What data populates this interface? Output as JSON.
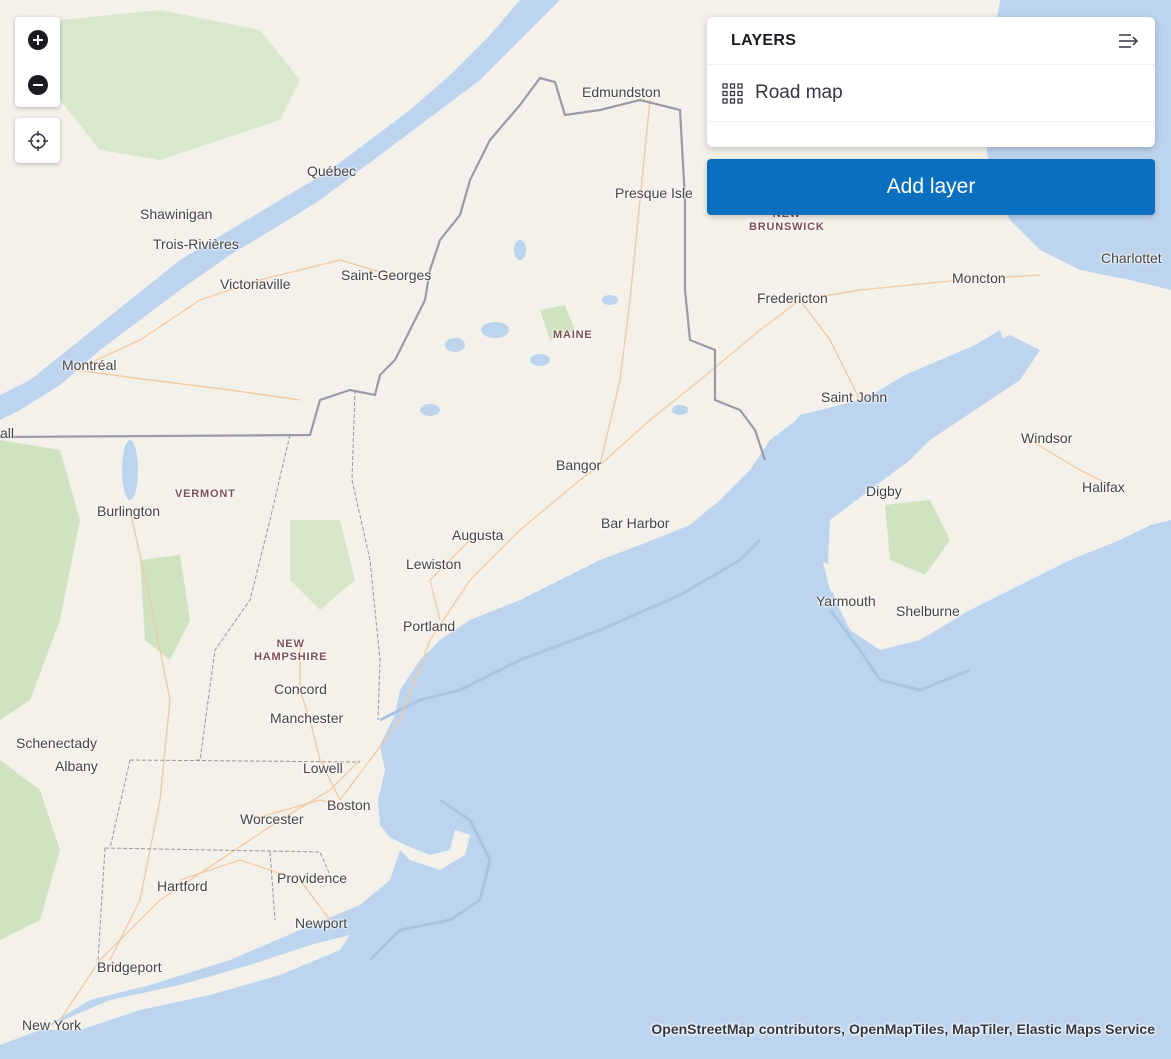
{
  "zoom_controls": {
    "zoom_in_icon": "plus-icon",
    "zoom_out_icon": "minus-icon",
    "locate_icon": "crosshair-icon"
  },
  "layers_panel": {
    "title": "LAYERS",
    "collapse_icon": "collapse-panel-icon",
    "layers": [
      {
        "name": "Road map",
        "icon": "grid-icon"
      }
    ],
    "add_layer_label": "Add layer"
  },
  "attribution": "OpenStreetMap contributors, OpenMapTiles, MapTiler, Elastic Maps Service",
  "colors": {
    "water": "#bcd4ee",
    "land": "#f4f0ea",
    "forest": "#cfe3c0",
    "accent": "#0a6fbf"
  },
  "map_labels": {
    "edmundston": "Edmundston",
    "quebec": "Québec",
    "presque_isle": "Presque Isle",
    "new_brunswick_1": "NEW",
    "new_brunswick_2": "BRUNSWICK",
    "shawinigan": "Shawinigan",
    "trois_rivieres": "Trois-Rivières",
    "victoriaville": "Victoriaville",
    "saint_georges": "Saint-Georges",
    "charlottetown": "Charlottet",
    "moncton": "Moncton",
    "fredericton": "Fredericton",
    "maine": "MAINE",
    "montreal": "Montréal",
    "saint_john": "Saint John",
    "edge_all": "all",
    "windsor": "Windsor",
    "bangor": "Bangor",
    "vermont": "VERMONT",
    "digby": "Digby",
    "halifax": "Halifax",
    "burlington": "Burlington",
    "bar_harbor": "Bar Harbor",
    "augusta": "Augusta",
    "lewiston": "Lewiston",
    "yarmouth": "Yarmouth",
    "shelburne": "Shelburne",
    "portland": "Portland",
    "new_hampshire_1": "NEW",
    "new_hampshire_2": "HAMPSHIRE",
    "concord": "Concord",
    "manchester": "Manchester",
    "schenectady": "Schenectady",
    "albany": "Albany",
    "lowell": "Lowell",
    "boston": "Boston",
    "worcester": "Worcester",
    "hartford": "Hartford",
    "providence": "Providence",
    "newport": "Newport",
    "bridgeport": "Bridgeport",
    "new_york": "New York"
  }
}
